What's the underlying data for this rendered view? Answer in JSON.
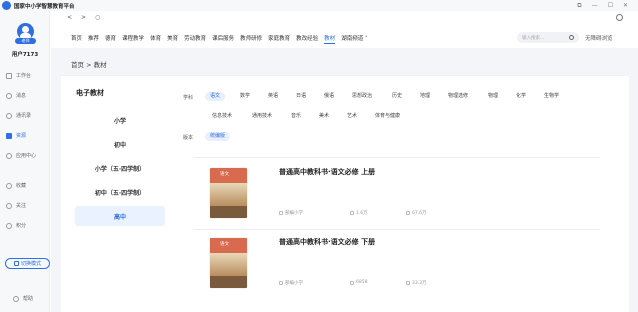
{
  "app": {
    "title": "国家中小学智慧教育平台"
  },
  "window": {
    "controls": [
      "⧉",
      "—",
      "☐",
      "✕"
    ]
  },
  "sidebar": {
    "avatar_badge": "老师",
    "username": "用户7173",
    "items": [
      {
        "label": "工作台",
        "icon": "workbench-icon"
      },
      {
        "label": "消息",
        "icon": "message-icon"
      },
      {
        "label": "通讯录",
        "icon": "contacts-icon"
      },
      {
        "label": "资源",
        "icon": "resource-icon",
        "active": true
      },
      {
        "label": "应用中心",
        "icon": "app-center-icon"
      },
      {
        "label": "收藏",
        "icon": "favorite-icon"
      },
      {
        "label": "关注",
        "icon": "follow-icon"
      },
      {
        "label": "积分",
        "icon": "points-icon"
      }
    ],
    "mode_button": "切换模式",
    "help": "帮助"
  },
  "browser": {
    "back": "<",
    "forward": ">",
    "refresh": "○"
  },
  "channels": [
    "首页",
    "推荐",
    "德育",
    "课程教学",
    "体育",
    "美育",
    "劳动教育",
    "课后服务",
    "教师研修",
    "家庭教育",
    "教改经验",
    "教材",
    "湖南频道 ˅"
  ],
  "active_channel": "教材",
  "search": {
    "placeholder": "输入搜索..."
  },
  "no_barrier": "无障碍浏览",
  "breadcrumb": "首页  >  教材",
  "left_panel": {
    "title": "电子教材",
    "stages": [
      "小学",
      "初中",
      "小学（五·四学制）",
      "初中（五·四学制）",
      "高中"
    ],
    "active_stage": "高中"
  },
  "filters": {
    "subject_label": "学科",
    "subjects_row1": [
      "语文",
      "数学",
      "英语",
      "日语",
      "俄语",
      "思想政治",
      "历史",
      "地理",
      "物理选修",
      "物理",
      "化学",
      "生物学"
    ],
    "subjects_row2": [
      "信息技术",
      "通用技术",
      "音乐",
      "美术",
      "艺术",
      "体育与健康"
    ],
    "active_subject": "语文",
    "edition_label": "版本",
    "editions": [
      "统编版"
    ]
  },
  "books": [
    {
      "title": "普通高中教科书·语文必修 上册",
      "cover_text": "语文",
      "publisher": "部编小学",
      "likes": "1.6万",
      "views": "67.6万"
    },
    {
      "title": "普通高中教科书·语文必修 下册",
      "cover_text": "语文",
      "publisher": "部编小学",
      "likes": "6858",
      "views": "33.3万"
    }
  ],
  "colors": {
    "accent": "#2f6fe4"
  }
}
